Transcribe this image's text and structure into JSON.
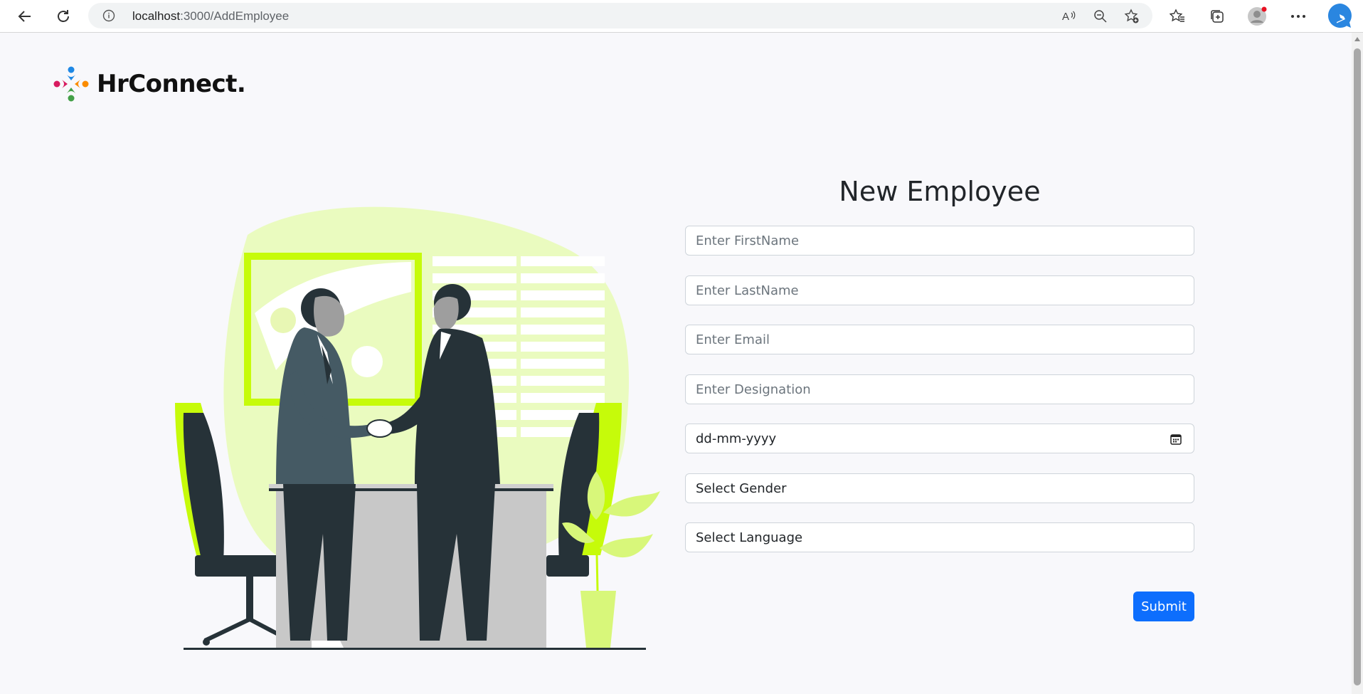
{
  "browser": {
    "url_host": "localhost",
    "url_path": ":3000/AddEmployee"
  },
  "brand": {
    "name": "HrConnect."
  },
  "form": {
    "title": "New Employee",
    "first_name_placeholder": "Enter FirstName",
    "last_name_placeholder": "Enter LastName",
    "email_placeholder": "Enter Email",
    "designation_placeholder": "Enter Designation",
    "dob_value": "dd-mm-yyyy",
    "gender_value": "Select Gender",
    "language_value": "Select Language",
    "submit_label": "Submit"
  },
  "colors": {
    "accent": "#0d6efd",
    "illustration_lime": "#c6fb0a",
    "illustration_dark": "#263238"
  },
  "icons": [
    "back-arrow-icon",
    "refresh-icon",
    "info-icon",
    "read-aloud-icon",
    "zoom-out-icon",
    "add-favorite-icon",
    "favorites-icon",
    "collections-icon",
    "profile-icon",
    "more-icon",
    "bing-icon",
    "calendar-icon"
  ]
}
